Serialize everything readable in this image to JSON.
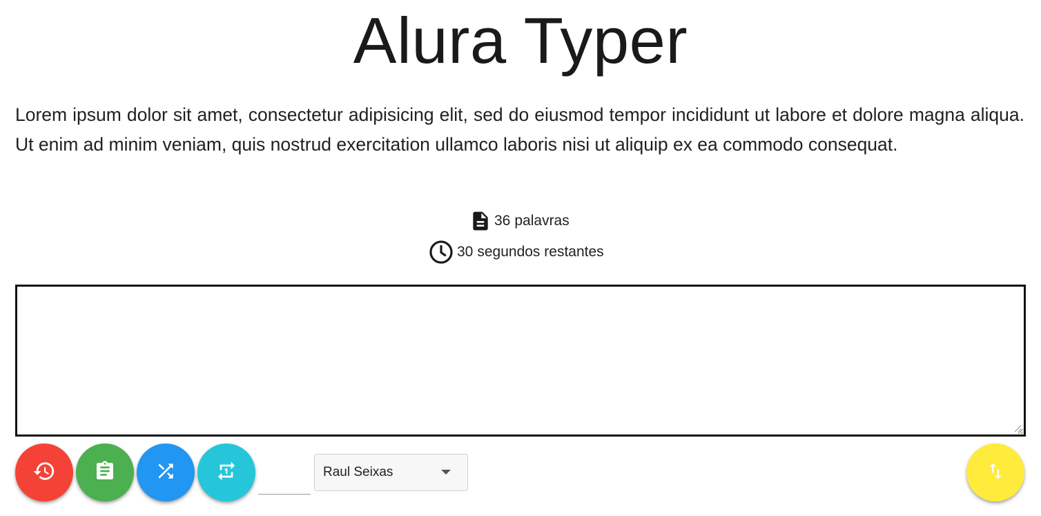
{
  "app": {
    "title": "Alura Typer"
  },
  "phrase": {
    "text": "Lorem ipsum dolor sit amet, consectetur adipisicing elit, sed do eiusmod tempor incididunt ut labore et dolore magna aliqua. Ut enim ad minim veniam, quis nostrud exercitation ullamco laboris nisi ut aliquip ex ea commodo consequat."
  },
  "info": {
    "word_count": "36",
    "word_label": "palavras",
    "time_count": "30",
    "time_label": "segundos restantes",
    "word_icon": "description-icon",
    "time_icon": "clock-icon"
  },
  "typing": {
    "value": "",
    "placeholder": ""
  },
  "controls": {
    "buttons": [
      {
        "name": "restart",
        "icon": "restore-icon",
        "color": "#f44336"
      },
      {
        "name": "scores",
        "icon": "assignment-icon",
        "color": "#4caf50"
      },
      {
        "name": "shuffle",
        "icon": "shuffle-icon",
        "color": "#2196f3"
      },
      {
        "name": "sync",
        "icon": "repeat-one-icon",
        "color": "#26c6da"
      },
      {
        "name": "toggle",
        "icon": "swap-vert-icon",
        "color": "#ffeb3b"
      }
    ],
    "phrase_id_value": "",
    "author_select": {
      "selected": "Raul Seixas"
    }
  }
}
